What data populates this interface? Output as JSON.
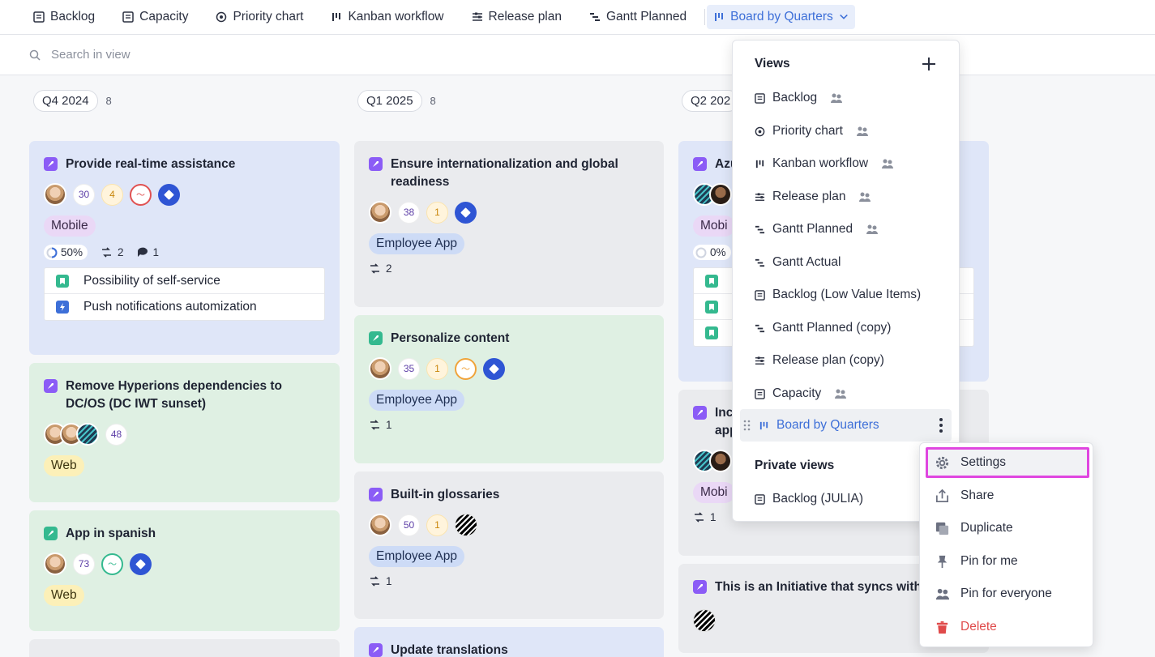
{
  "tabs": [
    {
      "label": "Backlog",
      "icon": "list-icon"
    },
    {
      "label": "Capacity",
      "icon": "list-icon"
    },
    {
      "label": "Priority chart",
      "icon": "target-icon"
    },
    {
      "label": "Kanban workflow",
      "icon": "kanban-icon"
    },
    {
      "label": "Release plan",
      "icon": "timeline-icon"
    },
    {
      "label": "Gantt Planned",
      "icon": "gantt-icon"
    },
    {
      "label": "Board by Quarters",
      "icon": "kanban-icon",
      "active": true
    }
  ],
  "search": {
    "placeholder": "Search in view"
  },
  "columns": [
    {
      "label": "Q4 2024",
      "count": "8"
    },
    {
      "label": "Q1 2025",
      "count": "8"
    },
    {
      "label": "Q2 202",
      "count": ""
    }
  ],
  "cards": {
    "c1": {
      "title": "Provide real-time assistance",
      "n1": "30",
      "n2": "4",
      "tag": "Mobile",
      "progress": "50%",
      "links": "2",
      "comments": "1",
      "subs": [
        "Possibility of self-service",
        "Push notifications automization"
      ]
    },
    "c2": {
      "title": "Remove Hyperions dependencies to DC/OS (DC IWT sunset)",
      "n1": "48",
      "tag": "Web"
    },
    "c3": {
      "title": "App in spanish",
      "n1": "73",
      "tag": "Web"
    },
    "c4": {
      "title": "Ensure internationalization and global readiness",
      "n1": "38",
      "n2": "1",
      "tag": "Employee App",
      "links": "2"
    },
    "c5": {
      "title": "Personalize content",
      "n1": "35",
      "n2": "1",
      "tag": "Employee App",
      "links": "1"
    },
    "c6": {
      "title": "Built-in glossaries",
      "n1": "50",
      "n2": "1",
      "tag": "Employee App",
      "links": "1"
    },
    "c7": {
      "title": "Update translations"
    },
    "c8": {
      "title": "Azu",
      "tag": "Mobi",
      "progress": "0%"
    },
    "c9": {
      "title": "Inc",
      "title2": "app",
      "tag": "Mobi",
      "links": "1"
    },
    "c10": {
      "title": "This is an Initiative that syncs with I"
    }
  },
  "views_menu": {
    "title": "Views",
    "items": [
      {
        "label": "Backlog",
        "icon": "list-icon",
        "shared": true
      },
      {
        "label": "Priority chart",
        "icon": "target-icon",
        "shared": true
      },
      {
        "label": "Kanban workflow",
        "icon": "kanban-icon",
        "shared": true
      },
      {
        "label": "Release plan",
        "icon": "timeline-icon",
        "shared": true
      },
      {
        "label": "Gantt Planned",
        "icon": "gantt-icon",
        "shared": true
      },
      {
        "label": "Gantt Actual",
        "icon": "gantt-icon",
        "shared": false
      },
      {
        "label": "Backlog (Low Value Items)",
        "icon": "list-icon",
        "shared": false
      },
      {
        "label": "Gantt Planned (copy)",
        "icon": "gantt-icon",
        "shared": false
      },
      {
        "label": "Release plan (copy)",
        "icon": "timeline-icon",
        "shared": false
      },
      {
        "label": "Capacity",
        "icon": "list-icon",
        "shared": true
      },
      {
        "label": "Board by Quarters",
        "icon": "kanban-icon",
        "selected": true
      }
    ],
    "private_title": "Private views",
    "private_items": [
      {
        "label": "Backlog (JULIA)",
        "icon": "list-icon"
      }
    ]
  },
  "context_menu": {
    "settings": "Settings",
    "share": "Share",
    "duplicate": "Duplicate",
    "pin_me": "Pin for me",
    "pin_everyone": "Pin for everyone",
    "delete": "Delete"
  },
  "colors": {
    "accent": "#3d6fd8",
    "highlight": "#e046e0",
    "danger": "#e04a4a"
  }
}
